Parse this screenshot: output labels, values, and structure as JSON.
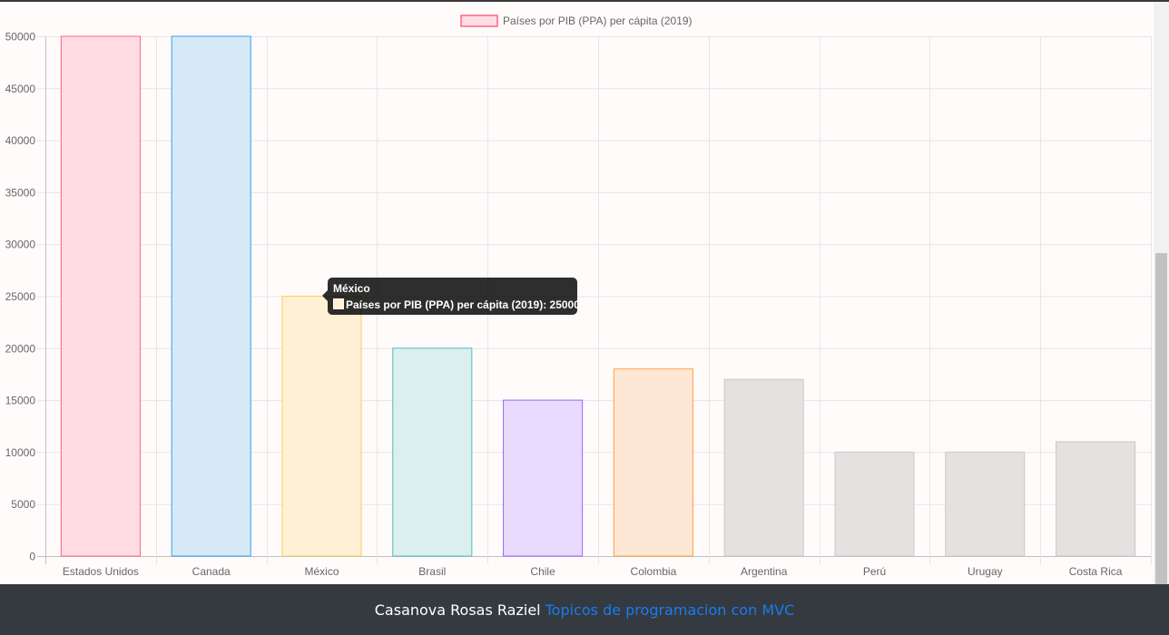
{
  "chart_data": {
    "type": "bar",
    "legend": {
      "label": "Países por PIB (PPA) per cápita (2019)",
      "swatch_fill": "#ffdde3",
      "swatch_stroke": "#ff6384",
      "position": "top"
    },
    "categories": [
      "Estados Unidos",
      "Canada",
      "México",
      "Brasil",
      "Chile",
      "Colombia",
      "Argentina",
      "Perú",
      "Urugay",
      "Costa Rica"
    ],
    "series": [
      {
        "name": "Países por PIB (PPA) per cápita (2019)",
        "values": [
          50000,
          50000,
          25000,
          20000,
          15000,
          18000,
          17000,
          10000,
          10000,
          11000
        ],
        "fill_colors": [
          "#ffdde3",
          "#d6e9f7",
          "#fff0d6",
          "#dbefee",
          "#e8dbfe",
          "#ffe7d6",
          "#e4e1e0",
          "#e4e1e0",
          "#e4e1e0",
          "#e4e1e0"
        ],
        "stroke_colors": [
          "#ff6384",
          "#36a2eb",
          "#ffce56",
          "#4bc0c0",
          "#9966ff",
          "#ff9f40",
          "#c9c9c9",
          "#c9c9c9",
          "#c9c9c9",
          "#c9c9c9"
        ]
      }
    ],
    "y_ticks": [
      "50000",
      "45000",
      "40000",
      "35000",
      "30000",
      "25000",
      "20000",
      "15000",
      "10000",
      "5000",
      "0"
    ],
    "ylim": [
      0,
      50000
    ],
    "grid": true
  },
  "tooltip": {
    "title": "México",
    "body": "Países por PIB (PPA) per cápita (2019): 25000"
  },
  "footer": {
    "author": "Casanova Rosas Raziel",
    "link": "Topicos de programacion con MVC"
  }
}
